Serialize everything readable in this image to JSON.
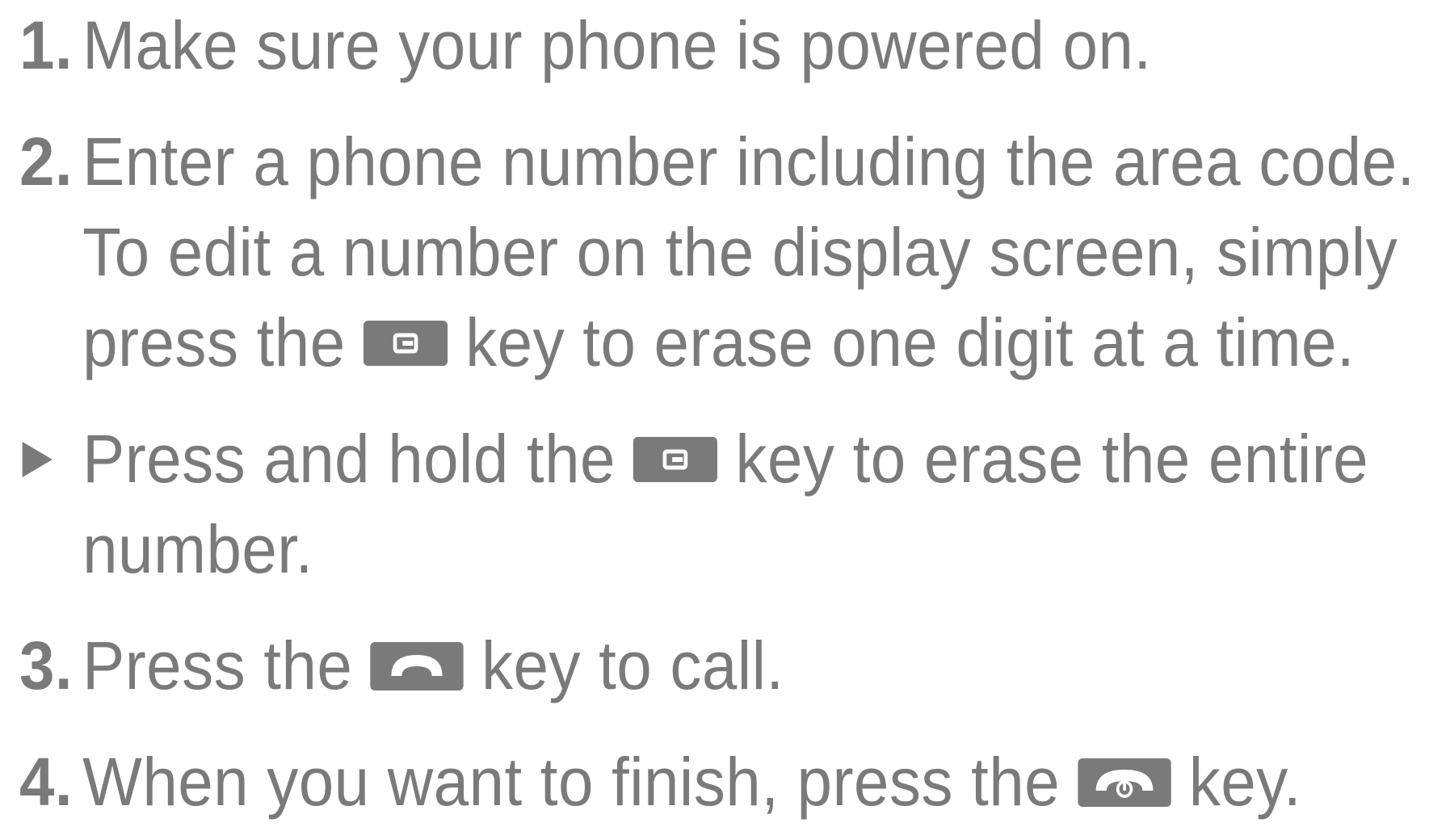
{
  "steps": [
    {
      "number": "1.",
      "text": "Make sure your phone is powered on."
    },
    {
      "number": "2.",
      "line1": "Enter a phone number including the area code.",
      "line2": "To edit a number on the display screen, simply",
      "line3_pre": "press the",
      "line3_post": "key to erase one digit at a time."
    },
    {
      "bullet": true,
      "line1_pre": "Press and hold the",
      "line1_post": "key to erase the entire",
      "line2": "number."
    },
    {
      "number": "3.",
      "pre": "Press the",
      "post": "key to call."
    },
    {
      "number": "4.",
      "pre": "When you want to finish, press the",
      "post": "key."
    }
  ],
  "icons": {
    "clear_key": "clear-key-icon",
    "send_key": "send-call-key-icon",
    "end_key": "end-call-key-icon",
    "bullet": "triangle-bullet-icon"
  },
  "colors": {
    "text": "#7a7a7a",
    "key_background": "#7a7a7a",
    "key_symbol": "#ffffff"
  }
}
